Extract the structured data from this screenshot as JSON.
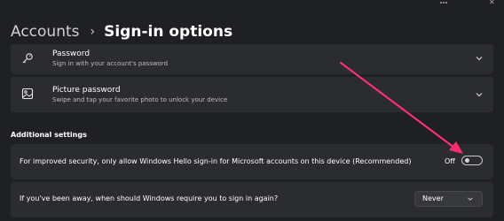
{
  "window": {
    "close_glyph": "✕"
  },
  "breadcrumb": {
    "parent": "Accounts",
    "separator": "›",
    "current": "Sign-in options"
  },
  "sign_in_options": [
    {
      "title": "Password",
      "subtitle": "Sign in with your account's password",
      "icon": "key-icon"
    },
    {
      "title": "Picture password",
      "subtitle": "Swipe and tap your favorite photo to unlock your device",
      "icon": "picture-icon"
    }
  ],
  "additional_settings": {
    "title": "Additional settings",
    "hello_only": {
      "label": "For improved security, only allow Windows Hello sign-in for Microsoft accounts on this device (Recommended)",
      "state": "Off"
    },
    "require_signin": {
      "label": "If you've been away, when should Windows require you to sign in again?",
      "value": "Never"
    }
  },
  "colors": {
    "annotation_arrow": "#ff2d6f",
    "background": "#1f2024",
    "card": "#2b2c30"
  }
}
